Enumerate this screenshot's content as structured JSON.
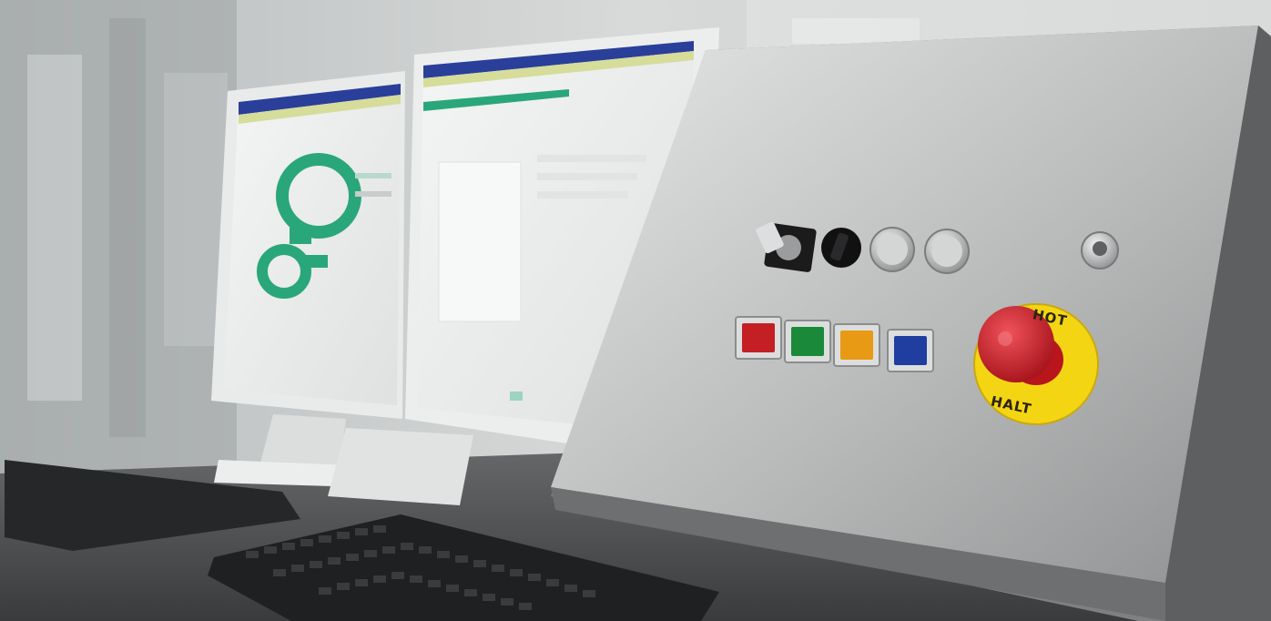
{
  "scene": {
    "description_kind": "photo",
    "emergency_stop": {
      "ring_text_top": "HOT",
      "ring_text_bottom": "HALT",
      "cap_color": "#d8222c",
      "ring_color": "#f3d514"
    },
    "indicator_buttons": [
      {
        "name": "red",
        "color": "#c41f24"
      },
      {
        "name": "green",
        "color": "#1a8a3a"
      },
      {
        "name": "amber",
        "color": "#e89a14"
      },
      {
        "name": "blue",
        "color": "#1f3ea0"
      }
    ],
    "monitor_accent": {
      "header_blue": "#2a3f9a",
      "ui_green": "#2aa77a"
    }
  }
}
